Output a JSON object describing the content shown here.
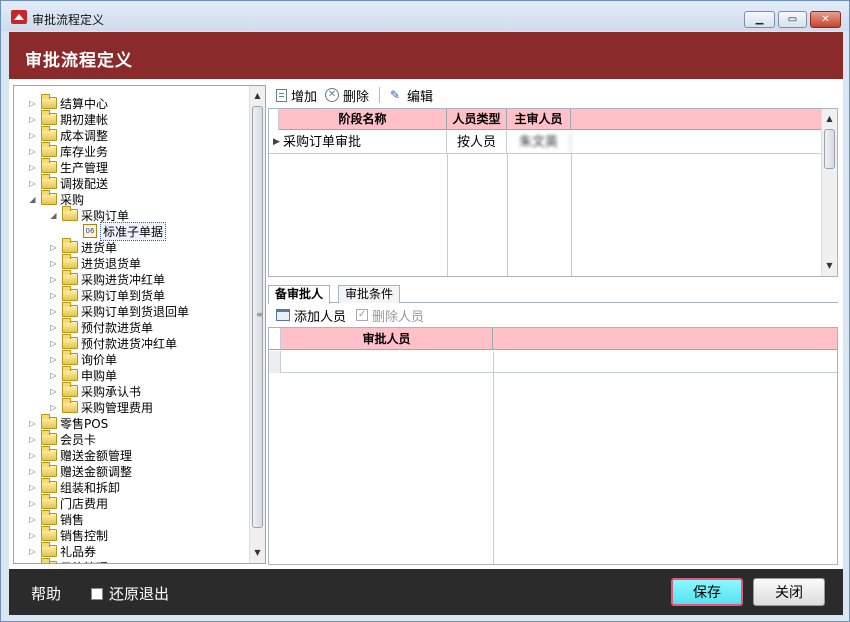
{
  "window": {
    "title": "审批流程定义",
    "controls": {
      "minimize": "▁",
      "maximize": "▭",
      "close": "✕"
    }
  },
  "header": {
    "title": "审批流程定义"
  },
  "tree": {
    "items": [
      {
        "label": "结算中心",
        "level": 0,
        "expander": "▷",
        "icon": "folder-icon"
      },
      {
        "label": "期初建帐",
        "level": 0,
        "expander": "▷",
        "icon": "folder-icon"
      },
      {
        "label": "成本调整",
        "level": 0,
        "expander": "▷",
        "icon": "folder-icon"
      },
      {
        "label": "库存业务",
        "level": 0,
        "expander": "▷",
        "icon": "folder-icon"
      },
      {
        "label": "生产管理",
        "level": 0,
        "expander": "▷",
        "icon": "folder-icon"
      },
      {
        "label": "调拨配送",
        "level": 0,
        "expander": "▷",
        "icon": "folder-icon"
      },
      {
        "label": "采购",
        "level": 0,
        "expander": "◢",
        "icon": "folder-icon"
      },
      {
        "label": "采购订单",
        "level": 1,
        "expander": "◢",
        "icon": "folder-icon"
      },
      {
        "label": "标准子单据",
        "level": 2,
        "expander": "",
        "icon": "document-icon",
        "selected": true
      },
      {
        "label": "进货单",
        "level": 1,
        "expander": "▷",
        "icon": "folder-icon"
      },
      {
        "label": "进货退货单",
        "level": 1,
        "expander": "▷",
        "icon": "folder-icon"
      },
      {
        "label": "采购进货冲红单",
        "level": 1,
        "expander": "▷",
        "icon": "folder-icon"
      },
      {
        "label": "采购订单到货单",
        "level": 1,
        "expander": "▷",
        "icon": "folder-icon"
      },
      {
        "label": "采购订单到货退回单",
        "level": 1,
        "expander": "▷",
        "icon": "folder-icon"
      },
      {
        "label": "预付款进货单",
        "level": 1,
        "expander": "▷",
        "icon": "folder-icon"
      },
      {
        "label": "预付款进货冲红单",
        "level": 1,
        "expander": "▷",
        "icon": "folder-icon"
      },
      {
        "label": "询价单",
        "level": 1,
        "expander": "▷",
        "icon": "folder-icon"
      },
      {
        "label": "申购单",
        "level": 1,
        "expander": "▷",
        "icon": "folder-icon"
      },
      {
        "label": "采购承认书",
        "level": 1,
        "expander": "▷",
        "icon": "folder-icon"
      },
      {
        "label": "采购管理费用",
        "level": 1,
        "expander": "▷",
        "icon": "folder-icon"
      },
      {
        "label": "零售POS",
        "level": 0,
        "expander": "▷",
        "icon": "folder-icon"
      },
      {
        "label": "会员卡",
        "level": 0,
        "expander": "▷",
        "icon": "folder-icon"
      },
      {
        "label": "赠送金额管理",
        "level": 0,
        "expander": "▷",
        "icon": "folder-icon"
      },
      {
        "label": "赠送金额调整",
        "level": 0,
        "expander": "▷",
        "icon": "folder-icon"
      },
      {
        "label": "组装和拆卸",
        "level": 0,
        "expander": "▷",
        "icon": "folder-icon"
      },
      {
        "label": "门店费用",
        "level": 0,
        "expander": "▷",
        "icon": "folder-icon"
      },
      {
        "label": "销售",
        "level": 0,
        "expander": "▷",
        "icon": "folder-icon"
      },
      {
        "label": "销售控制",
        "level": 0,
        "expander": "▷",
        "icon": "folder-icon"
      },
      {
        "label": "礼品券",
        "level": 0,
        "expander": "▷",
        "icon": "folder-icon"
      },
      {
        "label": "日终管理",
        "level": 0,
        "expander": "▷",
        "icon": "folder-icon"
      }
    ],
    "scroll": {
      "up": "▲",
      "down": "▼",
      "grip": "≡"
    }
  },
  "toolbar": {
    "add_label": "增加",
    "delete_label": "删除",
    "edit_label": "编辑",
    "delete_glyph": "✕",
    "edit_glyph": "✎"
  },
  "stage_grid": {
    "columns": [
      "阶段名称",
      "人员类型",
      "主审人员"
    ],
    "rows": [
      {
        "indicator": "▶",
        "stage_name": "采购订单审批",
        "person_type": "按人员",
        "approver": "朱文英"
      }
    ],
    "scroll": {
      "up": "▲",
      "down": "▼"
    }
  },
  "tabs": [
    {
      "label": "备审批人",
      "active": true
    },
    {
      "label": "审批条件",
      "active": false
    }
  ],
  "approver_toolbar": {
    "add_label": "添加人员",
    "delete_label": "删除人员",
    "delete_glyph": "✓"
  },
  "approver_grid": {
    "columns": [
      "审批人员"
    ]
  },
  "footer": {
    "help_label": "帮助",
    "restore_label": "还原退出",
    "save_label": "保存",
    "close_label": "关闭"
  },
  "colors": {
    "header_bg": "#8b2a2a",
    "grid_header_bg": "#ffc0c8",
    "footer_bg": "#2b2b2b",
    "save_button_bg": "#55e1f0"
  }
}
